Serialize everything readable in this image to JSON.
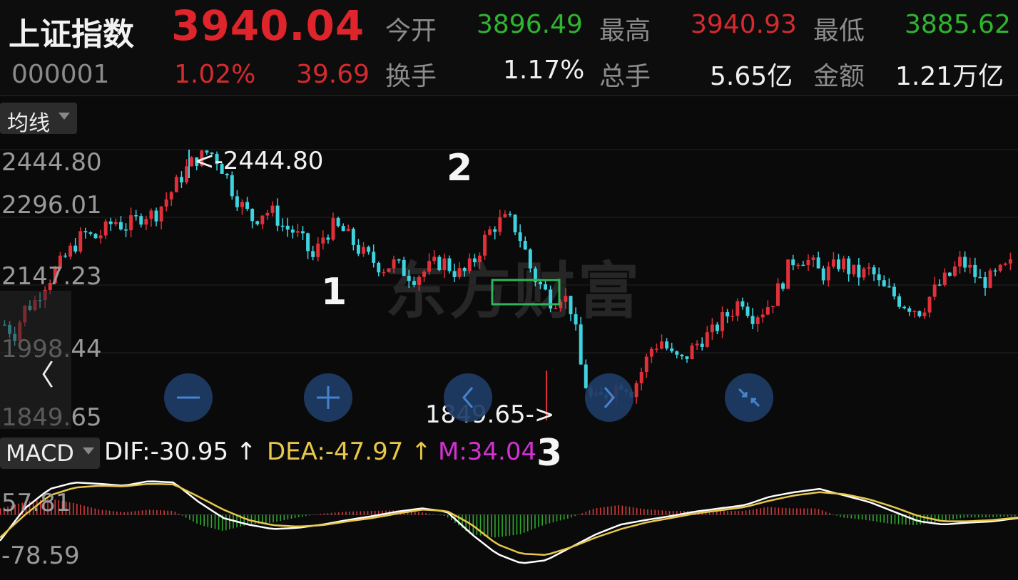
{
  "header": {
    "index_name": "上证指数",
    "price": "3940.04",
    "code": "000001",
    "change_pct": "1.02%",
    "change_pts": "39.69",
    "stats": [
      {
        "label": "今开",
        "value": "3896.49",
        "color": "#2fb52f"
      },
      {
        "label": "最高",
        "value": "3940.93",
        "color": "#d52a2f"
      },
      {
        "label": "最低",
        "value": "3885.62",
        "color": "#2fb52f"
      },
      {
        "label": "换手",
        "value": "1.17%",
        "color": "#f0f0f0"
      },
      {
        "label": "总手",
        "value": "5.65亿",
        "color": "#f0f0f0"
      },
      {
        "label": "金额",
        "value": "1.21万亿",
        "color": "#f0f0f0"
      }
    ]
  },
  "toolbar": {
    "ma_label": "均线",
    "macd_label": "MACD"
  },
  "watermark": "东方财富",
  "macd_readout": {
    "dif": "DIF:-30.95 ↑",
    "dea": "DEA:-47.97 ↑",
    "m": "M:34.04"
  },
  "annotations": {
    "label1": "1",
    "label2": "2",
    "label3": "3",
    "high_pointer": "<-2444.80",
    "low_pointer": "1849.65->"
  },
  "nav": {
    "back_glyph": "〈"
  },
  "colors": {
    "up": "#e0303a",
    "down": "#3fd3e0",
    "dif": "#ffffff",
    "dea": "#e8c84a",
    "macd_pos": "#d43a3a",
    "macd_neg": "#2fa82f",
    "box": "#2fb55a"
  },
  "icons": [
    "zoom-out-icon",
    "zoom-in-icon",
    "pan-left-icon",
    "pan-right-icon",
    "collapse-icon",
    "back-arrow-icon"
  ],
  "chart_data": [
    {
      "type": "candlestick",
      "title": "",
      "y_ticks": [
        "2444.80",
        "2296.01",
        "2147.23",
        "1998.44",
        "1849.65"
      ],
      "ylim": [
        1849.65,
        2444.8
      ],
      "high": 2444.8,
      "low": 1849.65,
      "close_path": [
        2060,
        2040,
        2095,
        2110,
        2150,
        2175,
        2205,
        2235,
        2260,
        2250,
        2265,
        2290,
        2275,
        2285,
        2305,
        2300,
        2330,
        2360,
        2395,
        2420,
        2440,
        2435,
        2400,
        2350,
        2315,
        2290,
        2310,
        2305,
        2275,
        2265,
        2240,
        2205,
        2255,
        2275,
        2265,
        2240,
        2215,
        2200,
        2185,
        2195,
        2180,
        2165,
        2175,
        2190,
        2200,
        2180,
        2170,
        2195,
        2240,
        2275,
        2290,
        2285,
        2240,
        2170,
        2140,
        2110,
        2130,
        2090,
        1950,
        1890,
        1900,
        1920,
        1935,
        1915,
        1960,
        2010,
        2025,
        1990,
        1980,
        2005,
        2030,
        2040,
        2070,
        2090,
        2120,
        2080,
        2090,
        2110,
        2150,
        2200,
        2210,
        2195,
        2170,
        2180,
        2200,
        2175,
        2170,
        2180,
        2140,
        2130,
        2110,
        2100,
        2090,
        2125,
        2150,
        2170,
        2200,
        2180,
        2155,
        2160,
        2175,
        2190
      ]
    },
    {
      "type": "line",
      "title": "MACD",
      "y_ticks": [
        "57.81",
        "-78.59"
      ],
      "ylim": [
        -78.59,
        57.81
      ],
      "series": [
        {
          "name": "DIF",
          "values": [
            -40,
            10,
            40,
            50,
            48,
            45,
            52,
            50,
            20,
            -5,
            -15,
            -22,
            -20,
            -15,
            -8,
            -2,
            5,
            10,
            5,
            -30,
            -60,
            -75,
            -70,
            -50,
            -30,
            -15,
            -8,
            -2,
            5,
            10,
            15,
            28,
            35,
            40,
            30,
            20,
            5,
            -10,
            -15,
            -12,
            -10,
            -5
          ]
        },
        {
          "name": "DEA",
          "values": [
            -35,
            0,
            30,
            42,
            45,
            44,
            48,
            47,
            28,
            8,
            -8,
            -16,
            -18,
            -16,
            -10,
            -5,
            2,
            8,
            6,
            -15,
            -45,
            -60,
            -62,
            -50,
            -35,
            -22,
            -12,
            -5,
            2,
            7,
            12,
            22,
            30,
            35,
            32,
            24,
            12,
            -2,
            -10,
            -10,
            -8,
            -4
          ]
        },
        {
          "name": "M",
          "values": [
            10,
            20,
            25,
            18,
            8,
            4,
            8,
            6,
            -15,
            -25,
            -15,
            -12,
            -4,
            2,
            5,
            6,
            7,
            4,
            -2,
            -30,
            -35,
            -30,
            -15,
            -5,
            10,
            15,
            9,
            6,
            6,
            6,
            6,
            12,
            10,
            10,
            -4,
            -8,
            -14,
            -16,
            -10,
            -4,
            -4,
            -2
          ]
        }
      ]
    }
  ]
}
